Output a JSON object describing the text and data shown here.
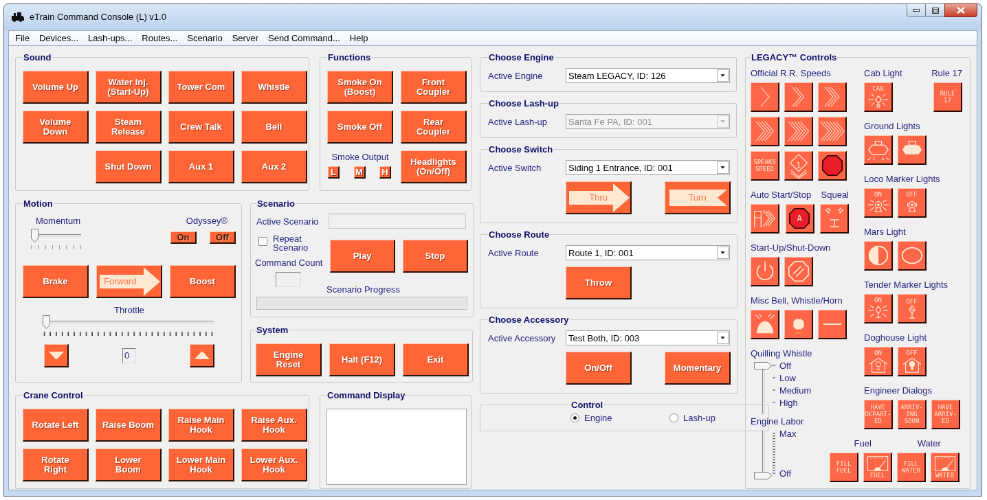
{
  "window": {
    "title": "eTrain Command Console (L) v1.0"
  },
  "menu": [
    "File",
    "Devices...",
    "Lash-ups...",
    "Routes...",
    "Scenario",
    "Server",
    "Send Command...",
    "Help"
  ],
  "sound": {
    "title": "Sound",
    "rows": [
      [
        "Volume Up",
        "Water Inj. (Start-Up)",
        "Tower Com",
        "Whistle"
      ],
      [
        "Volume Down",
        "Steam Release",
        "Crew Talk",
        "Bell"
      ],
      [
        "",
        "Shut Down",
        "Aux 1",
        "Aux 2"
      ]
    ]
  },
  "functions": {
    "title": "Functions",
    "buttons": [
      "Smoke On (Boost)",
      "Front Coupler",
      "Smoke Off",
      "Rear Coupler"
    ],
    "smoke_output": {
      "label": "Smoke Output",
      "buttons": [
        "L",
        "M",
        "H"
      ]
    },
    "headlights": "Headlights (On/Off)"
  },
  "motion": {
    "title": "Motion",
    "momentum": {
      "label": "Momentum",
      "level": 0
    },
    "odyssey": {
      "label": "Odyssey®",
      "buttons": [
        "On",
        "Off"
      ]
    },
    "buttons": [
      {
        "kind": "plain",
        "label": "Brake"
      },
      {
        "kind": "arrow",
        "label": "Forward"
      },
      {
        "kind": "plain",
        "label": "Boost"
      }
    ],
    "throttle": {
      "label": "Throttle",
      "level": 0,
      "value": "0"
    }
  },
  "scenario": {
    "title": "Scenario",
    "active_label": "Active Scenario",
    "repeat": {
      "label": "Repeat Scenario",
      "checked": false
    },
    "command_count_label": "Command Count",
    "buttons": [
      "Play",
      "Stop"
    ],
    "progress": {
      "label": "Scenario Progress",
      "level": 0
    }
  },
  "system": {
    "title": "System",
    "buttons": [
      "Engine Reset",
      "Halt (F12)",
      "Exit"
    ]
  },
  "crane": {
    "title": "Crane Control",
    "rows": [
      [
        "Rotate Left",
        "Raise Boom",
        "Raise Main Hook",
        "Raise Aux. Hook"
      ],
      [
        "Rotate Right",
        "Lower Boom",
        "Lower Main Hook",
        "Lower Aux. Hook"
      ]
    ]
  },
  "command_display": {
    "title": "Command Display"
  },
  "choosers": [
    {
      "title": "Choose Engine",
      "label": "Active Engine",
      "value": "Steam LEGACY, ID: 126",
      "disabled": false
    },
    {
      "title": "Choose Lash-up",
      "label": "Active Lash-up",
      "value": "Santa Fe PA, ID: 001",
      "disabled": true
    },
    {
      "title": "Choose Switch",
      "label": "Active Switch",
      "value": "Siding 1 Entrance, ID: 001",
      "disabled": false,
      "buttons": [
        {
          "kind": "arrow",
          "label": "Thru"
        },
        {
          "kind": "notched",
          "label": "Turn"
        }
      ]
    },
    {
      "title": "Choose Route",
      "label": "Active Route",
      "value": "Route 1, ID: 001",
      "disabled": false,
      "buttons": [
        {
          "kind": "plain",
          "label": "Throw"
        }
      ]
    },
    {
      "title": "Choose Accessory",
      "label": "Active Accessory",
      "value": "Test Both, ID: 003",
      "disabled": false,
      "buttons": [
        {
          "kind": "plain",
          "label": "On/Off"
        },
        {
          "kind": "plain",
          "label": "Momentary"
        }
      ]
    }
  ],
  "control": {
    "title": "Control",
    "options": [
      {
        "label": "Engine",
        "selected": true
      },
      {
        "label": "Lash-up",
        "selected": false
      }
    ]
  },
  "legacy": {
    "title": "LEGACY™ Controls",
    "left": [
      {
        "kind": "buttons",
        "labels": [
          "Official R.R. Speeds"
        ],
        "buttons": [
          {
            "kind": "chevron-1"
          },
          {
            "kind": "chevron-2"
          },
          {
            "kind": "chevron-3"
          },
          {
            "kind": "chevron-4"
          },
          {
            "kind": "chevron-5"
          },
          {
            "kind": "chevron-6"
          },
          {
            "kind": "text",
            "text": [
              "SPEAKS",
              "SPEED"
            ]
          },
          {
            "kind": "diamond",
            "text": [
              "1"
            ]
          },
          {
            "kind": "stop"
          }
        ]
      },
      {
        "kind": "buttons",
        "labels": [
          "Auto Start/Stop",
          "Squeal"
        ],
        "buttons": [
          {
            "kind": "flag"
          },
          {
            "kind": "stop",
            "text": [
              "A"
            ]
          },
          {
            "kind": "squeal"
          }
        ]
      },
      {
        "kind": "buttons",
        "labels": [
          "Start-Up/Shut-Down"
        ],
        "buttons": [
          {
            "kind": "power"
          },
          {
            "kind": "no-entry"
          }
        ]
      },
      {
        "kind": "buttons",
        "labels": [
          "Misc Bell, Whistle/Horn"
        ],
        "buttons": [
          {
            "kind": "bell"
          },
          {
            "kind": "whistle"
          },
          {
            "kind": "horn"
          }
        ]
      },
      {
        "kind": "notched-slider",
        "label": "Quilling Whistle",
        "marks": [
          "Off",
          "Low",
          "Medium",
          "High"
        ]
      },
      {
        "kind": "range-slider",
        "label": "Engine Labor",
        "level": 0,
        "marks": [
          "Max",
          "Off"
        ]
      }
    ],
    "right": [
      {
        "kind": "buttons",
        "labels": [
          "Cab Light",
          "Rule 17"
        ],
        "buttons": [
          {
            "kind": "cab",
            "text": [
              "CAB"
            ]
          },
          {
            "kind": "text",
            "text": [
              "RULE",
              "17"
            ]
          }
        ]
      },
      {
        "kind": "buttons",
        "labels": [
          "Ground Lights"
        ],
        "buttons": [
          {
            "kind": "ground-open"
          },
          {
            "kind": "ground-filled"
          }
        ]
      },
      {
        "kind": "buttons",
        "labels": [
          "Loco Marker Lights"
        ],
        "buttons": [
          {
            "kind": "marker-on",
            "text": [
              "ON"
            ]
          },
          {
            "kind": "marker-off",
            "text": [
              "OFF"
            ]
          }
        ]
      },
      {
        "kind": "buttons",
        "labels": [
          "Mars Light"
        ],
        "buttons": [
          {
            "kind": "mars-half"
          },
          {
            "kind": "mars-oval"
          }
        ]
      },
      {
        "kind": "buttons",
        "labels": [
          "Tender Marker Lights"
        ],
        "buttons": [
          {
            "kind": "tender-on",
            "text": [
              "ON"
            ]
          },
          {
            "kind": "tender-off",
            "text": [
              "OFF"
            ]
          }
        ]
      },
      {
        "kind": "buttons",
        "labels": [
          "Doghouse Light"
        ],
        "buttons": [
          {
            "kind": "house-open",
            "text": [
              "ON"
            ]
          },
          {
            "kind": "house-filled",
            "text": [
              "OFF"
            ]
          }
        ]
      },
      {
        "kind": "buttons",
        "labels": [
          "Engineer Dialogs"
        ],
        "buttons": [
          {
            "kind": "text",
            "text": [
              "HAVE",
              "DEPART-",
              "ED"
            ]
          },
          {
            "kind": "text",
            "text": [
              "ARRIV-",
              "ING",
              "SOON"
            ]
          },
          {
            "kind": "text",
            "text": [
              "HAVE",
              "ARRIV-",
              "ED"
            ]
          }
        ]
      },
      {
        "kind": "supply",
        "labels": [
          "Fuel",
          "Water"
        ],
        "buttons": [
          {
            "kind": "text",
            "text": [
              "FILL",
              "FUEL"
            ]
          },
          {
            "kind": "gauge",
            "text": [
              "FUEL"
            ]
          },
          {
            "kind": "text",
            "text": [
              "FILL",
              "WATER"
            ]
          },
          {
            "kind": "gauge",
            "text": [
              "WATER"
            ]
          }
        ]
      }
    ]
  }
}
